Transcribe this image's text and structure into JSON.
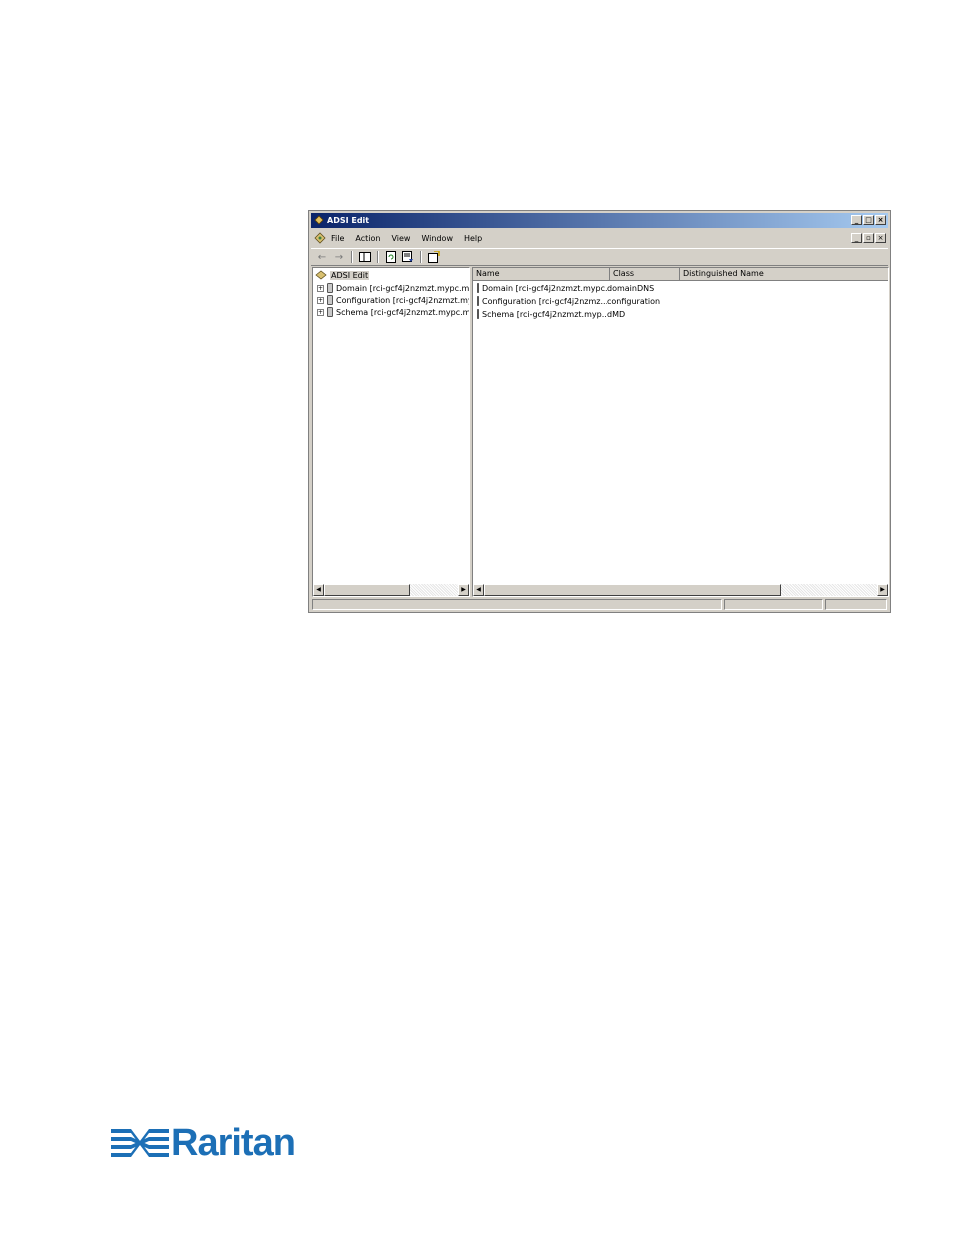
{
  "window": {
    "title": "ADSI Edit",
    "caption_buttons": [
      "_",
      "□",
      "×"
    ],
    "mdi_buttons": [
      "_",
      "▫",
      "×"
    ]
  },
  "menu": {
    "items": [
      "File",
      "Action",
      "View",
      "Window",
      "Help"
    ]
  },
  "toolbar": {
    "icons": [
      "back-arrow-icon",
      "forward-arrow-icon",
      "show-hide-tree-icon",
      "refresh-icon",
      "export-list-icon",
      "properties-icon"
    ]
  },
  "tree": {
    "root": "ADSI Edit",
    "nodes": [
      {
        "label": "Domain [rci-gcf4j2nzmzt.mypc.my"
      },
      {
        "label": "Configuration [rci-gcf4j2nzmzt.my"
      },
      {
        "label": "Schema [rci-gcf4j2nzmzt.mypc.m"
      }
    ]
  },
  "list": {
    "columns": [
      "Name",
      "Class",
      "Distinguished Name"
    ],
    "rows": [
      {
        "name": "Domain [rci-gcf4j2nzmzt.mypc....",
        "class": "domainDNS"
      },
      {
        "name": "Configuration [rci-gcf4j2nzmz...",
        "class": "configuration"
      },
      {
        "name": "Schema [rci-gcf4j2nzmzt.myp....",
        "class": "dMD"
      }
    ]
  },
  "brand": {
    "name": "Raritan",
    "color": "#1c6fb6"
  }
}
